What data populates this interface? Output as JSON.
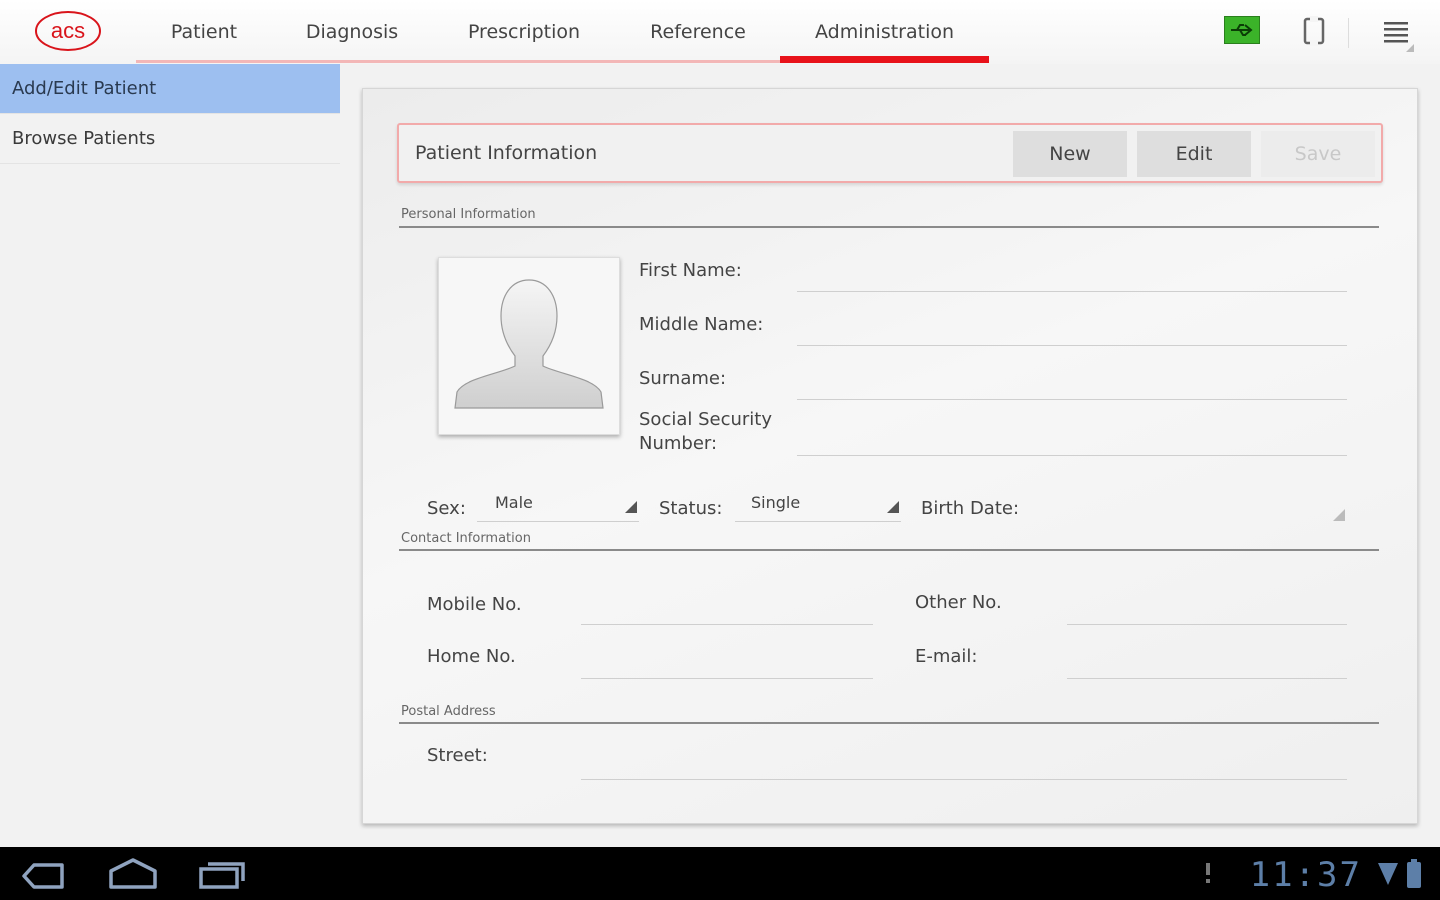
{
  "app": {
    "logo_text": "acs",
    "colors": {
      "accent": "#e8121a",
      "tab_underline": "#f3b7b7",
      "sidebar_active": "#9dbff0",
      "usb_green": "#3bb329",
      "clock_blue": "#5d7fa8"
    }
  },
  "tabs": [
    {
      "label": "Patient",
      "active": false
    },
    {
      "label": "Diagnosis",
      "active": false
    },
    {
      "label": "Prescription",
      "active": false
    },
    {
      "label": "Reference",
      "active": false
    },
    {
      "label": "Administration",
      "active": true
    }
  ],
  "top_icons": [
    "usb-icon",
    "rotate-icon",
    "menu-icon"
  ],
  "sidebar": {
    "items": [
      {
        "label": "Add/Edit Patient",
        "active": true
      },
      {
        "label": "Browse Patients",
        "active": false
      }
    ]
  },
  "patient_info": {
    "title": "Patient Information",
    "buttons": {
      "new": "New",
      "edit": "Edit",
      "save": "Save"
    }
  },
  "personal": {
    "section_label": "Personal Information",
    "first_name_label": "First Name:",
    "first_name_value": "",
    "middle_name_label": "Middle Name:",
    "middle_name_value": "",
    "surname_label": "Surname:",
    "surname_value": "",
    "ssn_label_line1": "Social Security",
    "ssn_label_line2": "Number:",
    "ssn_value": "",
    "sex_label": "Sex:",
    "sex_value": "Male",
    "status_label": "Status:",
    "status_value": "Single",
    "birth_date_label": "Birth Date:",
    "birth_date_value": ""
  },
  "contact": {
    "section_label": "Contact Information",
    "mobile_label": "Mobile No.",
    "mobile_value": "",
    "other_label": "Other No.",
    "other_value": "",
    "home_label": "Home No.",
    "home_value": "",
    "email_label": "E-mail:",
    "email_value": ""
  },
  "postal": {
    "section_label": "Postal Address",
    "street_label": "Street:",
    "street_value": ""
  },
  "system_bar": {
    "clock": "11:37",
    "icons": [
      "back-icon",
      "home-icon",
      "recent-apps-icon",
      "notification-icon",
      "wifi-icon",
      "battery-icon"
    ]
  }
}
